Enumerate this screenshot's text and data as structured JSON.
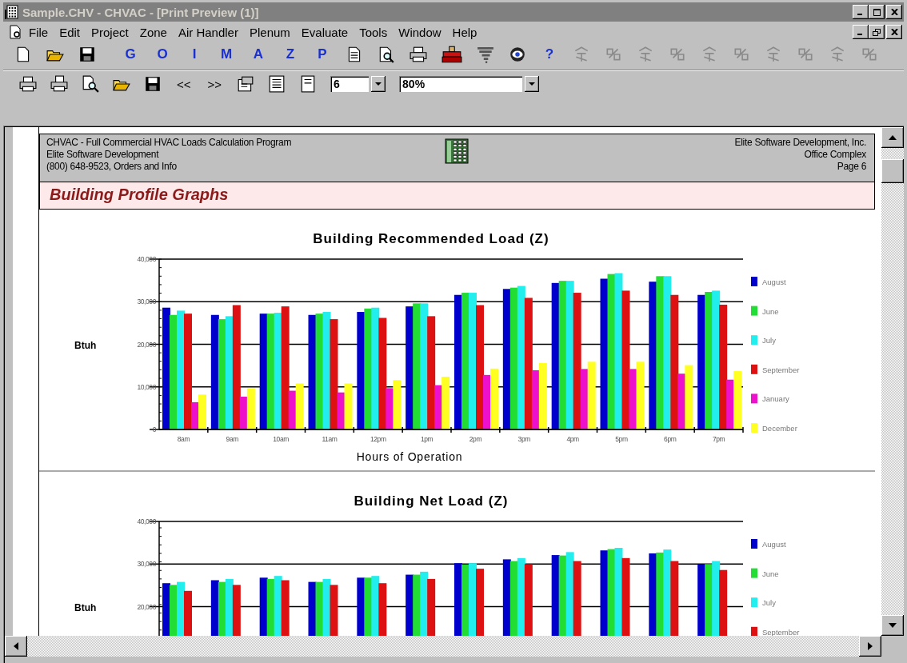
{
  "window": {
    "title": "Sample.CHV - CHVAC - [Print Preview (1)]"
  },
  "menu": [
    {
      "label": "File"
    },
    {
      "label": "Edit"
    },
    {
      "label": "Project"
    },
    {
      "label": "Zone"
    },
    {
      "label": "Air Handler"
    },
    {
      "label": "Plenum"
    },
    {
      "label": "Evaluate"
    },
    {
      "label": "Tools"
    },
    {
      "label": "Window"
    },
    {
      "label": "Help"
    }
  ],
  "letter_buttons": [
    "G",
    "O",
    "I",
    "M",
    "A",
    "Z",
    "P"
  ],
  "help_button": "?",
  "preview_toolbar": {
    "prev": "<<",
    "next": ">>",
    "page": "6",
    "zoom": "80%"
  },
  "page": {
    "header_left": [
      "CHVAC - Full Commercial HVAC Loads Calculation Program",
      "Elite Software Development",
      "(800) 648-9523, Orders and Info"
    ],
    "header_right": [
      "Elite Software Development, Inc.",
      "Office Complex",
      "Page 6"
    ],
    "heading": "Building Profile Graphs"
  },
  "charts": [
    {
      "chart_data": {
        "type": "bar",
        "title": "Building Recommended Load (Z)",
        "xlabel": "Hours of Operation",
        "ylabel": "Btuh",
        "grid": true,
        "legend": true,
        "categories": [
          "8am",
          "9am",
          "10am",
          "11am",
          "12pm",
          "1pm",
          "2pm",
          "3pm",
          "4pm",
          "5pm",
          "6pm",
          "7pm"
        ],
        "ylim": [
          0,
          40000
        ],
        "yticks": [
          {
            "value": 0,
            "label": "0"
          },
          {
            "value": 10000,
            "label": "10,000"
          },
          {
            "value": 20000,
            "label": "20,000"
          },
          {
            "value": 30000,
            "label": "30,000"
          },
          {
            "value": 40000,
            "label": "40,000"
          }
        ],
        "series": [
          {
            "name": "August",
            "color": "#0000cc",
            "values": [
              28600,
              26900,
              27200,
              26900,
              27600,
              28900,
              31600,
              33000,
              34400,
              35400,
              34700,
              31600
            ]
          },
          {
            "name": "June",
            "color": "#22dd33",
            "values": [
              26900,
              25900,
              27200,
              27200,
              28400,
              29600,
              32100,
              33300,
              34900,
              36500,
              36000,
              32300
            ]
          },
          {
            "name": "July",
            "color": "#22eeee",
            "values": [
              27900,
              26600,
              27400,
              27600,
              28600,
              29600,
              32100,
              33700,
              34900,
              36700,
              36000,
              32600
            ]
          },
          {
            "name": "September",
            "color": "#dd1111",
            "values": [
              27200,
              29200,
              28900,
              25900,
              26200,
              26600,
              29200,
              30900,
              32100,
              32600,
              31600,
              29300
            ]
          },
          {
            "name": "January",
            "color": "#ee11cc",
            "values": [
              6400,
              7700,
              9100,
              8700,
              9700,
              10400,
              12800,
              13900,
              14200,
              14200,
              13100,
              11700
            ]
          },
          {
            "name": "December",
            "color": "#ffff22",
            "values": [
              8200,
              9700,
              10800,
              10800,
              11600,
              12400,
              14300,
              15600,
              15900,
              15900,
              15100,
              13700
            ]
          }
        ]
      }
    },
    {
      "chart_data": {
        "type": "bar",
        "title": "Building Net Load (Z)",
        "ylabel": "Btuh",
        "grid": true,
        "legend": true,
        "ylim": [
          12500,
          40000
        ],
        "yticks": [
          {
            "value": 20000,
            "label": "20,000"
          },
          {
            "value": 30000,
            "label": "30,000"
          },
          {
            "value": 40000,
            "label": "40,000"
          }
        ],
        "series": [
          {
            "name": "August",
            "color": "#0000cc",
            "values": [
              25500,
              26200,
              26800,
              25800,
              26800,
              27500,
              30200,
              31100,
              32100,
              33200,
              32500,
              30000
            ]
          },
          {
            "name": "June",
            "color": "#22dd33",
            "values": [
              25100,
              25800,
              26500,
              25800,
              26800,
              27500,
              29900,
              30700,
              32000,
              33500,
              32700,
              30000
            ]
          },
          {
            "name": "July",
            "color": "#22eeee",
            "values": [
              25800,
              26500,
              27200,
              26500,
              27200,
              28200,
              30200,
              31400,
              32800,
              33800,
              33400,
              30700
            ]
          },
          {
            "name": "September",
            "color": "#dd1111",
            "values": [
              23700,
              25100,
              26200,
              25100,
              25500,
              26500,
              28900,
              30000,
              30700,
              31400,
              30700,
              28600
            ]
          }
        ]
      }
    }
  ]
}
